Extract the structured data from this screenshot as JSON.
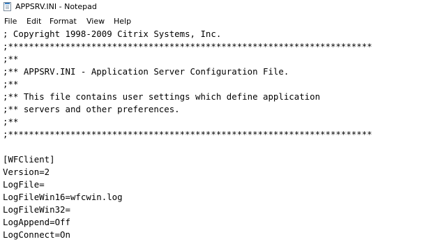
{
  "window": {
    "title": "APPSRV.INI - Notepad"
  },
  "menu": [
    "File",
    "Edit",
    "Format",
    "View",
    "Help"
  ],
  "document": {
    "lines": [
      "; Copyright 1998-2009 Citrix Systems, Inc.",
      ";**********************************************************************",
      ";**",
      ";** APPSRV.INI - Application Server Configuration File.",
      ";**",
      ";** This file contains user settings which define application",
      ";** servers and other preferences.",
      ";**",
      ";**********************************************************************",
      "",
      "[WFClient]",
      "Version=2",
      "LogFile=",
      "LogFileWin16=wfcwin.log",
      "LogFileWin32=",
      "LogAppend=Off",
      "LogConnect=On"
    ]
  }
}
